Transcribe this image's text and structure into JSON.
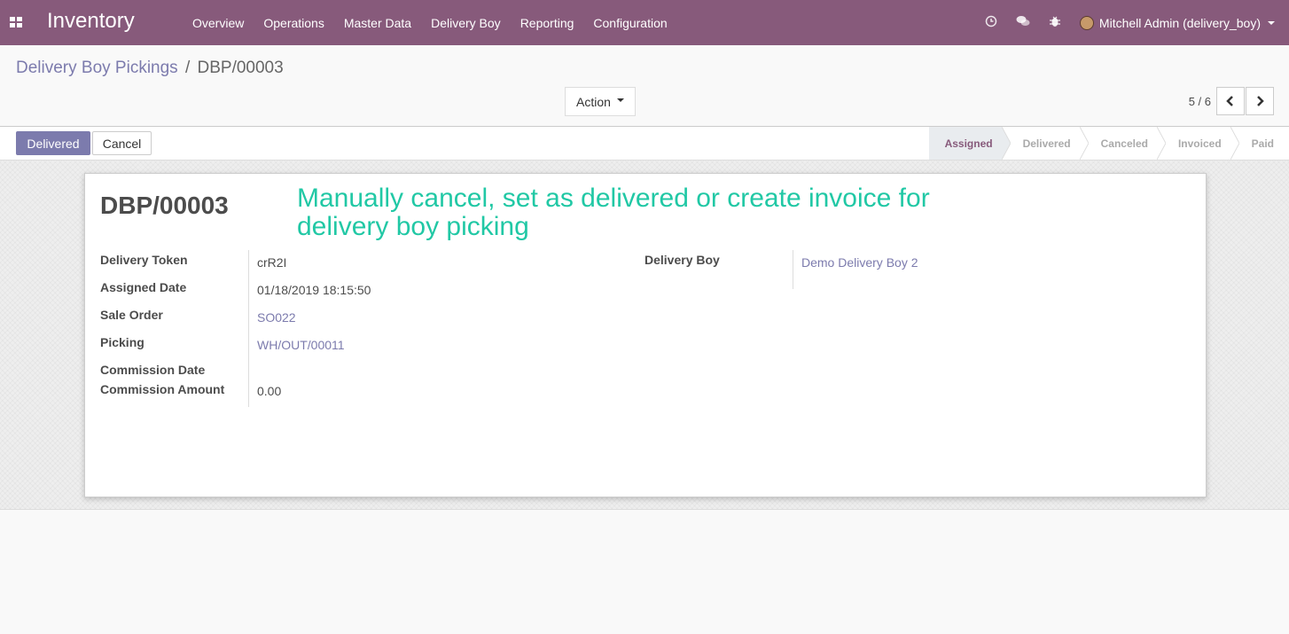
{
  "navbar": {
    "brand": "Inventory",
    "menu": [
      "Overview",
      "Operations",
      "Master Data",
      "Delivery Boy",
      "Reporting",
      "Configuration"
    ],
    "user": "Mitchell Admin (delivery_boy)"
  },
  "breadcrumb": {
    "parent": "Delivery Boy Pickings",
    "separator": "/",
    "current": "DBP/00003"
  },
  "control": {
    "action_label": "Action",
    "pager_value": "5 / 6"
  },
  "statusbar": {
    "primary_button": "Delivered",
    "secondary_button": "Cancel",
    "stages": [
      "Assigned",
      "Delivered",
      "Canceled",
      "Invoiced",
      "Paid"
    ],
    "active_stage": "Assigned"
  },
  "record": {
    "name": "DBP/00003",
    "annotation": "Manually cancel, set as delivered or create invoice for delivery boy picking",
    "fields": {
      "delivery_token": {
        "label": "Delivery Token",
        "value": "crR2I"
      },
      "assigned_date": {
        "label": "Assigned Date",
        "value": "01/18/2019 18:15:50"
      },
      "sale_order": {
        "label": "Sale Order",
        "value": "SO022"
      },
      "picking": {
        "label": "Picking",
        "value": "WH/OUT/00011"
      },
      "commission_date": {
        "label": "Commission Date",
        "value": ""
      },
      "commission_amount": {
        "label": "Commission Amount",
        "value": "0.00"
      },
      "delivery_boy": {
        "label": "Delivery Boy",
        "value": "Demo Delivery Boy 2"
      }
    }
  },
  "colors": {
    "navbar": "#875a7b",
    "link": "#7c7bad",
    "annotation": "#21c8a5"
  }
}
